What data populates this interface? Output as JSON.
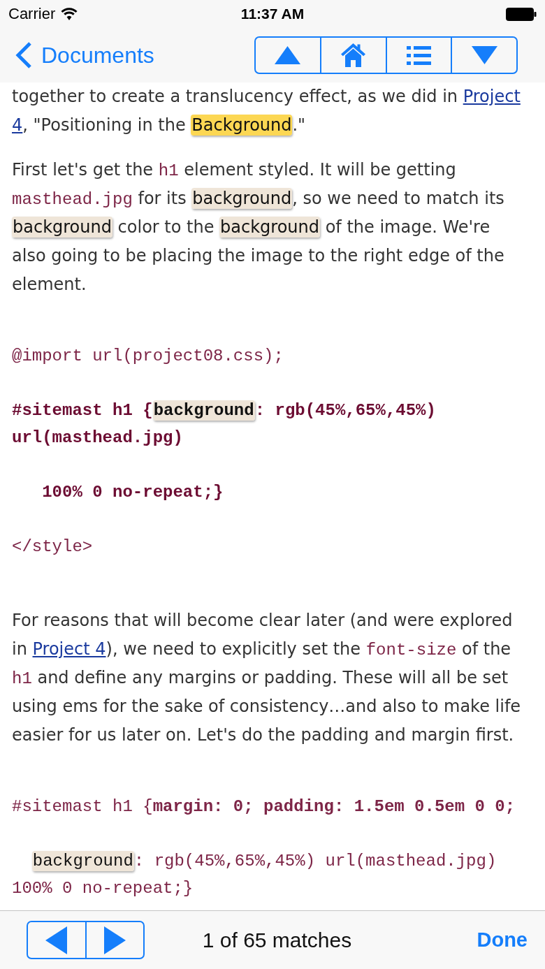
{
  "status_bar": {
    "carrier": "Carrier",
    "time": "11:37 AM"
  },
  "nav_bar": {
    "back_label": "Documents"
  },
  "content": {
    "blocks": [
      {
        "kind": "paragraph",
        "lines": [
          {
            "segments": [
              {
                "kind": "text",
                "text": "together to create a translucency effect, as we did in "
              },
              {
                "kind": "link",
                "text": "Project"
              }
            ]
          },
          {
            "segments": [
              {
                "kind": "link",
                "text": "4"
              },
              {
                "kind": "text",
                "text": ", \"Positioning in the "
              },
              {
                "kind": "match",
                "text": "Background",
                "selected": true
              },
              {
                "kind": "text",
                "text": ".\""
              }
            ]
          }
        ]
      },
      {
        "kind": "paragraph",
        "lines": [
          {
            "segments": [
              {
                "kind": "text",
                "text": "First let's get the "
              },
              {
                "kind": "code",
                "text": "h1"
              },
              {
                "kind": "text",
                "text": " element styled. It will be getting"
              }
            ]
          },
          {
            "segments": [
              {
                "kind": "code",
                "text": "masthead.jpg"
              },
              {
                "kind": "text",
                "text": " for its "
              },
              {
                "kind": "match",
                "text": "background",
                "selected": false
              },
              {
                "kind": "text",
                "text": ", so we need to match its"
              }
            ]
          },
          {
            "segments": [
              {
                "kind": "match",
                "text": "background",
                "selected": false
              },
              {
                "kind": "text",
                "text": " color to the "
              },
              {
                "kind": "match",
                "text": "background",
                "selected": false
              },
              {
                "kind": "text",
                "text": " of the image. We're"
              }
            ]
          },
          {
            "segments": [
              {
                "kind": "text",
                "text": "also going to be placing the image to the right edge of the"
              }
            ]
          },
          {
            "segments": [
              {
                "kind": "text",
                "text": "element."
              }
            ]
          }
        ]
      },
      {
        "kind": "code",
        "lines": [
          {
            "bold": false,
            "indented": false,
            "segments": [
              {
                "kind": "text",
                "text": "@import url(project08.css);"
              }
            ]
          }
        ]
      },
      {
        "kind": "code",
        "lines": [
          {
            "bold": true,
            "indented": false,
            "segments": [
              {
                "kind": "text",
                "text": "#sitemast h1 {"
              },
              {
                "kind": "match",
                "text": "background",
                "selected": false
              },
              {
                "kind": "text",
                "text": ": rgb(45%,65%,45%)"
              }
            ]
          },
          {
            "bold": true,
            "indented": false,
            "segments": [
              {
                "kind": "text",
                "text": "url(masthead.jpg)"
              }
            ]
          }
        ]
      },
      {
        "kind": "code",
        "lines": [
          {
            "bold": true,
            "indented": false,
            "segments": [
              {
                "kind": "text",
                "text": "   100% 0 no-repeat;}"
              }
            ]
          }
        ]
      },
      {
        "kind": "code",
        "lines": [
          {
            "bold": false,
            "indented": false,
            "segments": [
              {
                "kind": "text",
                "text": "</style>"
              }
            ]
          }
        ]
      },
      {
        "kind": "paragraph",
        "lines": [
          {
            "segments": [
              {
                "kind": "text",
                "text": "For reasons that will become clear later (and were explored"
              }
            ]
          },
          {
            "segments": [
              {
                "kind": "text",
                "text": "in "
              },
              {
                "kind": "link",
                "text": "Project 4"
              },
              {
                "kind": "text",
                "text": "), we need to explicitly set the "
              },
              {
                "kind": "code",
                "text": "font-size"
              },
              {
                "kind": "text",
                "text": " of the"
              }
            ]
          },
          {
            "segments": [
              {
                "kind": "code",
                "text": "h1"
              },
              {
                "kind": "text",
                "text": " and define any margins or padding. These will all be set"
              }
            ]
          },
          {
            "segments": [
              {
                "kind": "text",
                "text": "using ems for the sake of consistency…and also to make life"
              }
            ]
          },
          {
            "segments": [
              {
                "kind": "text",
                "text": "easier for us later on. Let's do the padding and margin first."
              }
            ]
          }
        ]
      },
      {
        "kind": "code",
        "lines": [
          {
            "bold": false,
            "indented": false,
            "segments": [
              {
                "kind": "text",
                "text": "#sitemast h1 {**margin: 0; padding: 1.5em 0.5em 0 0;**"
              }
            ]
          }
        ]
      },
      {
        "kind": "code",
        "lines": [
          {
            "bold": false,
            "indented": true,
            "segments": [
              {
                "kind": "match",
                "text": "background",
                "selected": false
              },
              {
                "kind": "text",
                "text": ": rgb(45%,65%,45%) url(masthead.jpg)"
              }
            ]
          },
          {
            "bold": false,
            "indented": false,
            "segments": [
              {
                "kind": "text",
                "text": "100% 0 no-repeat;}"
              }
            ]
          }
        ]
      }
    ]
  },
  "find_bar": {
    "match_count": "1 of 65 matches",
    "done_label": "Done"
  }
}
